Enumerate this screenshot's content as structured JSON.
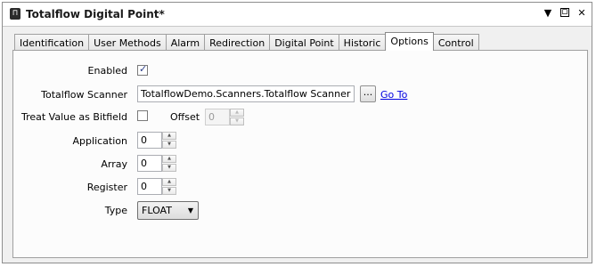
{
  "window": {
    "title": "Totalflow Digital Point*",
    "app_icon_glyph": "⊓",
    "controls": {
      "dropdown": "▼",
      "maximize": "▫",
      "close": "✕"
    }
  },
  "tabs": [
    {
      "label": "Identification"
    },
    {
      "label": "User Methods"
    },
    {
      "label": "Alarm"
    },
    {
      "label": "Redirection"
    },
    {
      "label": "Digital Point"
    },
    {
      "label": "Historic"
    },
    {
      "label": "Options",
      "active": true
    },
    {
      "label": "Control"
    }
  ],
  "form": {
    "enabled": {
      "label": "Enabled",
      "checked": true,
      "check_glyph": "✓"
    },
    "scanner": {
      "label": "Totalflow Scanner",
      "value": "TotalflowDemo.Scanners.Totalflow Scanner",
      "browse_label": "...",
      "goto_label": "Go To"
    },
    "bitfield": {
      "label": "Treat Value as Bitfield",
      "checked": false
    },
    "offset": {
      "label": "Offset",
      "value": "0"
    },
    "application": {
      "label": "Application",
      "value": "0"
    },
    "array": {
      "label": "Array",
      "value": "0"
    },
    "register": {
      "label": "Register",
      "value": "0"
    },
    "type": {
      "label": "Type",
      "value": "FLOAT",
      "arrow": "▼"
    }
  },
  "spin_glyphs": {
    "up": "▲",
    "down": "▼"
  }
}
